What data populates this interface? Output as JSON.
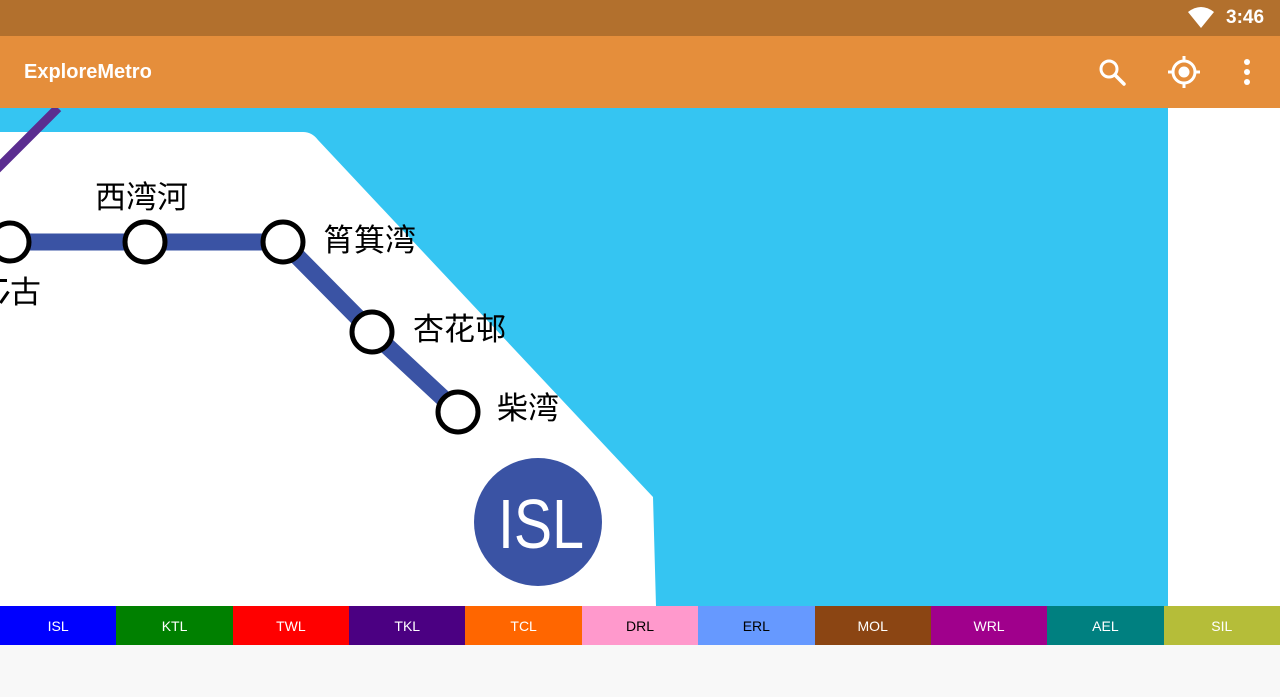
{
  "status_bar": {
    "time": "3:46"
  },
  "app_bar": {
    "title": "ExploreMetro",
    "actions": [
      "search-icon",
      "my-location-icon",
      "more-vert-icon"
    ]
  },
  "map": {
    "water_color": "#35c5f2",
    "line_color": "#3a53a4",
    "stations": [
      {
        "name": "西湾河"
      },
      {
        "name": "筲箕湾"
      },
      {
        "name": "杏花邨"
      },
      {
        "name": "柴湾"
      },
      {
        "name": "太古",
        "partial_visible": "古"
      }
    ],
    "line_badge": "ISL"
  },
  "line_tabs": [
    {
      "label": "ISL",
      "color": "#0000ff",
      "text_color": "#ffffff"
    },
    {
      "label": "KTL",
      "color": "#008000",
      "text_color": "#ffffff"
    },
    {
      "label": "TWL",
      "color": "#ff0000",
      "text_color": "#ffffff"
    },
    {
      "label": "TKL",
      "color": "#4b0082",
      "text_color": "#ffffff"
    },
    {
      "label": "TCL",
      "color": "#ff6600",
      "text_color": "#ffffff"
    },
    {
      "label": "DRL",
      "color": "#ff99cc",
      "text_color": "#000000"
    },
    {
      "label": "ERL",
      "color": "#6699ff",
      "text_color": "#000000"
    },
    {
      "label": "MOL",
      "color": "#8b4513",
      "text_color": "#ffffff"
    },
    {
      "label": "WRL",
      "color": "#a0008c",
      "text_color": "#ffffff"
    },
    {
      "label": "AEL",
      "color": "#008080",
      "text_color": "#ffffff"
    },
    {
      "label": "SIL",
      "color": "#b5bd39",
      "text_color": "#ffffff"
    }
  ]
}
